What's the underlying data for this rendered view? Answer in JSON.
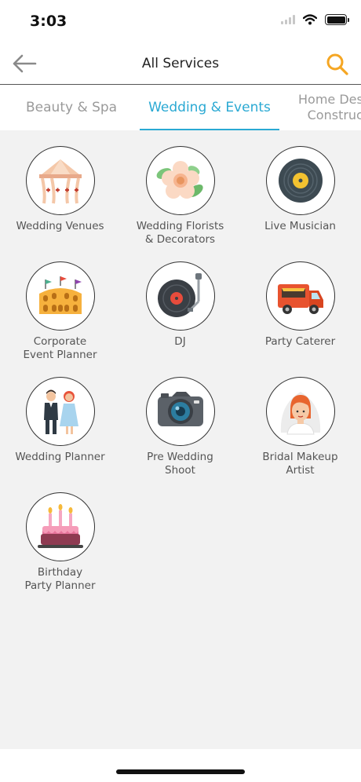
{
  "status_bar": {
    "time": "3:03",
    "icons": [
      "cellular-signal-icon",
      "wifi-icon",
      "battery-icon"
    ]
  },
  "header": {
    "title": "All Services",
    "back_icon": "arrow-left-icon",
    "search_icon": "search-icon",
    "accent_color": "#f5a623"
  },
  "tabs": [
    {
      "label": "Beauty & Spa",
      "active": false
    },
    {
      "label": "Wedding & Events",
      "active": true
    },
    {
      "label": "Home Design &\nConstruction",
      "active": false
    }
  ],
  "active_tab_color": "#2aa9d3",
  "services": [
    {
      "label": "Wedding Venues",
      "icon": "wedding-tent-icon"
    },
    {
      "label": "Wedding Florists\n& Decorators",
      "icon": "flower-icon"
    },
    {
      "label": "Live Musician",
      "icon": "vinyl-record-icon"
    },
    {
      "label": "Corporate\nEvent Planner",
      "icon": "colosseum-icon"
    },
    {
      "label": "DJ",
      "icon": "turntable-icon"
    },
    {
      "label": "Party Caterer",
      "icon": "food-truck-icon"
    },
    {
      "label": "Wedding Planner",
      "icon": "bride-groom-icon"
    },
    {
      "label": "Pre Wedding\nShoot",
      "icon": "camera-icon"
    },
    {
      "label": "Bridal Makeup\nArtist",
      "icon": "bride-icon"
    },
    {
      "label": "Birthday\nParty Planner",
      "icon": "birthday-cake-icon"
    }
  ]
}
